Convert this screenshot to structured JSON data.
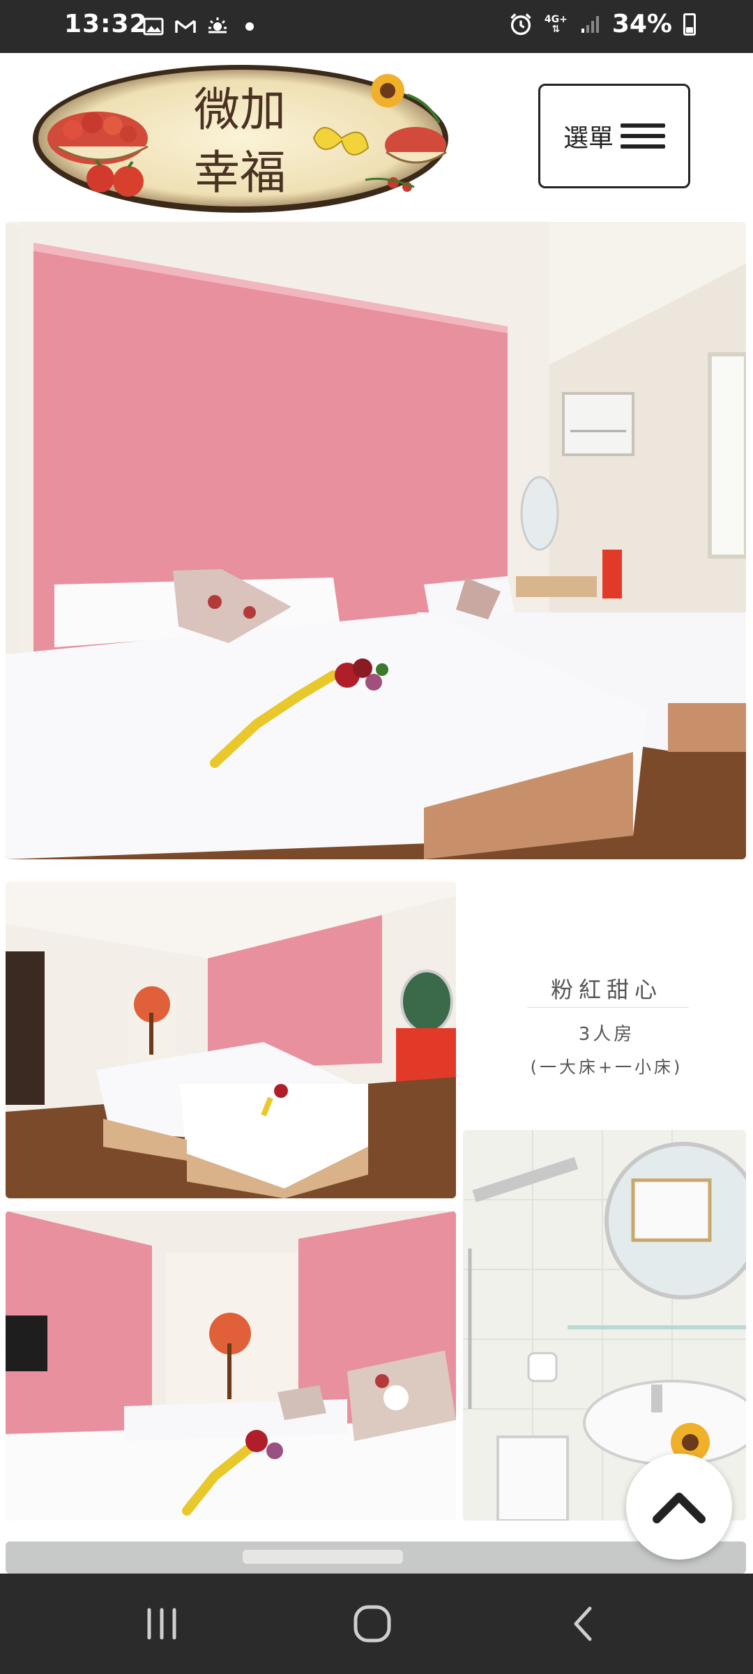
{
  "status_bar": {
    "time": "13:32",
    "notification_icons": [
      "gallery-icon",
      "gmail-icon",
      "weather-icon",
      "dot-icon"
    ],
    "network_label": "4G+",
    "battery_percent": "34%"
  },
  "header": {
    "logo_text_line1": "微加",
    "logo_text_line2": "幸福",
    "menu_label": "選單"
  },
  "room": {
    "name": "粉紅甜心",
    "type": "3人房",
    "beds": "(一大床+一小床)"
  },
  "photos": [
    {
      "id": "hero",
      "desc": "main-bedroom-photo"
    },
    {
      "id": "room-wide",
      "desc": "room-wide-photo"
    },
    {
      "id": "room-side",
      "desc": "room-side-photo"
    },
    {
      "id": "bathroom",
      "desc": "bathroom-photo"
    }
  ],
  "colors": {
    "accent_pink": "#e8909d",
    "status_bar": "#2b2b2b",
    "text_dark": "#222222"
  },
  "nav_bar": {
    "buttons": [
      "recent-apps-icon",
      "home-icon",
      "back-icon"
    ]
  }
}
